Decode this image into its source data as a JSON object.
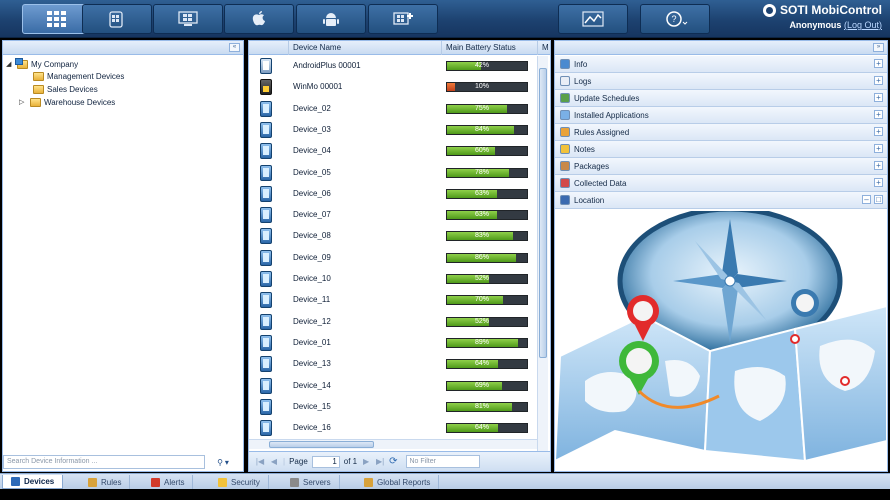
{
  "app": {
    "brand": "SOTI MobiControl",
    "user": "Anonymous",
    "logout": "(Log Out)"
  },
  "nav": {
    "buttons": [
      {
        "name": "devices-view-button",
        "icon": "grid-icon"
      },
      {
        "name": "windows-mobile-button",
        "icon": "windows-flag-icon"
      },
      {
        "name": "windows-desktop-button",
        "icon": "windows-pc-icon"
      },
      {
        "name": "apple-button",
        "icon": "apple-icon"
      },
      {
        "name": "android-button",
        "icon": "android-icon"
      },
      {
        "name": "windows-add-button",
        "icon": "windows-plus-icon"
      },
      {
        "name": "reports-button",
        "icon": "chart-icon"
      },
      {
        "name": "help-button",
        "icon": "help-icon"
      }
    ]
  },
  "tree": {
    "root": "My Company",
    "children": [
      "Management Devices",
      "Sales Devices",
      "Warehouse Devices"
    ],
    "search_placeholder": "Search Device Information ..."
  },
  "grid": {
    "columns": [
      "Device Name",
      "Main Battery Status",
      "M"
    ],
    "rows": [
      {
        "name": "AndroidPlus 00001",
        "battery": 42,
        "type": "android"
      },
      {
        "name": "WinMo 00001",
        "battery": 10,
        "type": "winmo"
      },
      {
        "name": "Device_02",
        "battery": 75,
        "type": "phone"
      },
      {
        "name": "Device_03",
        "battery": 84,
        "type": "phone"
      },
      {
        "name": "Device_04",
        "battery": 60,
        "type": "phone"
      },
      {
        "name": "Device_05",
        "battery": 78,
        "type": "phone"
      },
      {
        "name": "Device_06",
        "battery": 63,
        "type": "phone"
      },
      {
        "name": "Device_07",
        "battery": 63,
        "type": "phone"
      },
      {
        "name": "Device_08",
        "battery": 83,
        "type": "phone"
      },
      {
        "name": "Device_09",
        "battery": 86,
        "type": "phone"
      },
      {
        "name": "Device_10",
        "battery": 52,
        "type": "phone"
      },
      {
        "name": "Device_11",
        "battery": 70,
        "type": "phone"
      },
      {
        "name": "Device_12",
        "battery": 52,
        "type": "phone"
      },
      {
        "name": "Device_01",
        "battery": 89,
        "type": "phone"
      },
      {
        "name": "Device_13",
        "battery": 64,
        "type": "phone"
      },
      {
        "name": "Device_14",
        "battery": 69,
        "type": "phone"
      },
      {
        "name": "Device_15",
        "battery": 81,
        "type": "phone"
      },
      {
        "name": "Device_16",
        "battery": 64,
        "type": "phone"
      }
    ],
    "pager": {
      "label": "Page",
      "page": "1",
      "of": "of 1",
      "filter_placeholder": "No Filter"
    }
  },
  "info": {
    "sections": [
      {
        "label": "Info",
        "color": "#4a8ad0"
      },
      {
        "label": "Logs",
        "color": "#e9eef6"
      },
      {
        "label": "Update Schedules",
        "color": "#5aa04a"
      },
      {
        "label": "Installed Applications",
        "color": "#7ab0e6"
      },
      {
        "label": "Rules Assigned",
        "color": "#e8a23a"
      },
      {
        "label": "Notes",
        "color": "#f2c23a"
      },
      {
        "label": "Packages",
        "color": "#c8894a"
      },
      {
        "label": "Collected Data",
        "color": "#d24a4a"
      },
      {
        "label": "Location",
        "color": "#3a6ab0"
      }
    ]
  },
  "bottom_tabs": [
    {
      "label": "Devices",
      "active": true,
      "color": "#2d6ab8"
    },
    {
      "label": "Rules",
      "active": false,
      "color": "#d8a23a"
    },
    {
      "label": "Alerts",
      "active": false,
      "color": "#d23a2a"
    },
    {
      "label": "Security",
      "active": false,
      "color": "#f2c23a"
    },
    {
      "label": "Servers",
      "active": false,
      "color": "#8a8a8a"
    },
    {
      "label": "Global Reports",
      "active": false,
      "color": "#d8a23a"
    }
  ]
}
